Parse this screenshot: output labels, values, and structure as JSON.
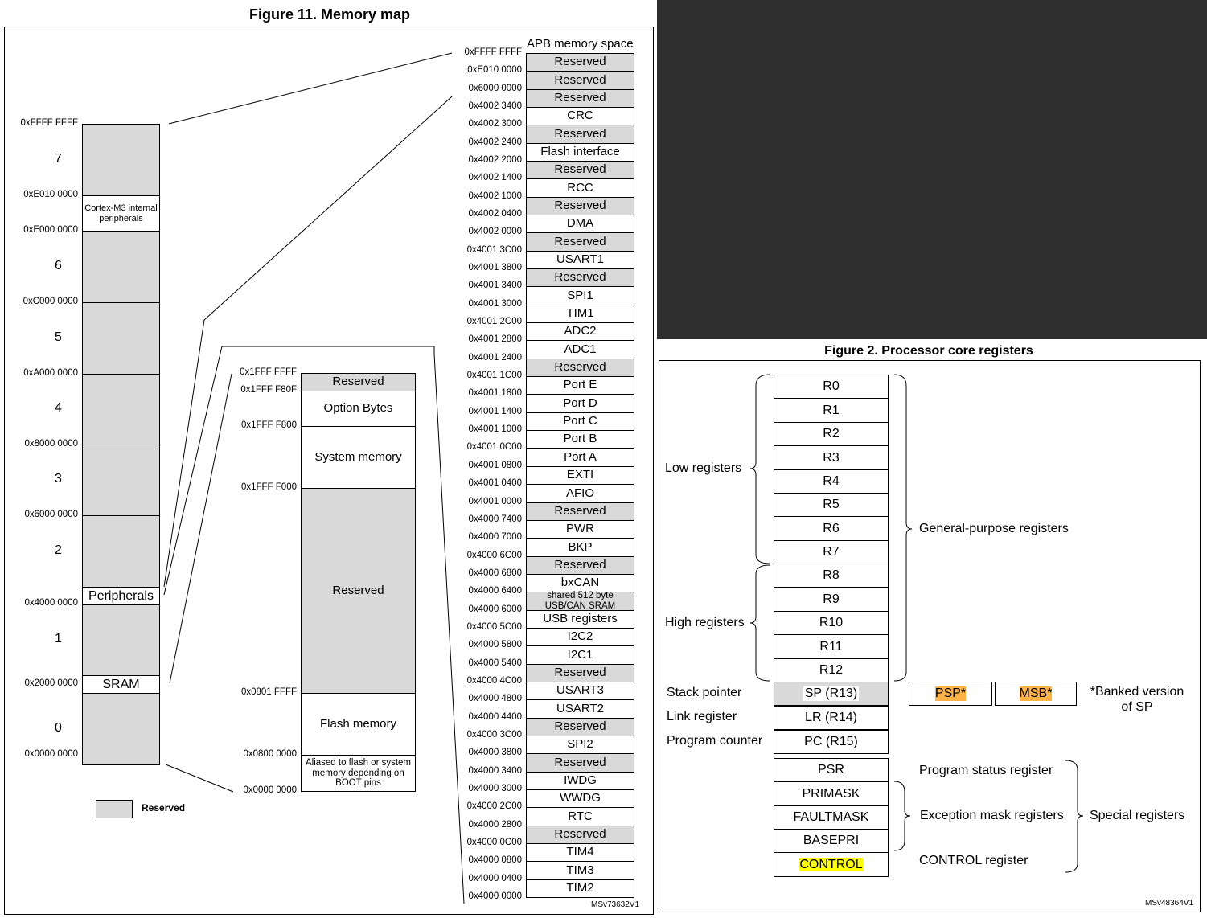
{
  "memory_map": {
    "title": "Figure 11. Memory map",
    "code": "MSv73632V1",
    "legend_label": "Reserved",
    "regions": [
      {
        "label": "7",
        "gray": true
      },
      {
        "label": "Cortex-M3 internal peripherals",
        "gray": false
      },
      {
        "label": "6",
        "gray": true
      },
      {
        "label": "5",
        "gray": true
      },
      {
        "label": "4",
        "gray": true
      },
      {
        "label": "3",
        "gray": true
      },
      {
        "label": "2",
        "gray": true
      },
      {
        "label": "Peripherals",
        "gray": false
      },
      {
        "label": "1",
        "gray": true
      },
      {
        "label": "SRAM",
        "gray": false
      },
      {
        "label": "0",
        "gray": true
      }
    ],
    "addresses": [
      "0xFFFF FFFF",
      "0xE010 0000",
      "0xE000 0000",
      "0xC000 0000",
      "0xA000 0000",
      "0x8000 0000",
      "0x6000 0000",
      "0x4000 0000",
      "0x2000 0000",
      "0x0000 0000"
    ],
    "code_region": {
      "cells": [
        {
          "label": "Reserved",
          "gray": true
        },
        {
          "label": "Option Bytes",
          "gray": false
        },
        {
          "label": "System memory",
          "gray": false
        },
        {
          "label": "Reserved",
          "gray": true
        },
        {
          "label": "Flash memory",
          "gray": false
        },
        {
          "label": "Aliased to flash or system memory depending on BOOT pins",
          "gray": false
        }
      ],
      "addresses": [
        "0x1FFF FFFF",
        "0x1FFF F80F",
        "0x1FFF F800",
        "0x1FFF F000",
        "0x0801 FFFF",
        "0x0800 0000",
        "0x0000 0000"
      ]
    },
    "apb": {
      "title": "APB memory space",
      "cells": [
        {
          "label": "Reserved",
          "gray": true
        },
        {
          "label": "Reserved",
          "gray": true
        },
        {
          "label": "Reserved",
          "gray": true
        },
        {
          "label": "CRC",
          "gray": false
        },
        {
          "label": "Reserved",
          "gray": true
        },
        {
          "label": "Flash interface",
          "gray": false
        },
        {
          "label": "Reserved",
          "gray": true
        },
        {
          "label": "RCC",
          "gray": false
        },
        {
          "label": "Reserved",
          "gray": true
        },
        {
          "label": "DMA",
          "gray": false
        },
        {
          "label": "Reserved",
          "gray": true
        },
        {
          "label": "USART1",
          "gray": false
        },
        {
          "label": "Reserved",
          "gray": true
        },
        {
          "label": "SPI1",
          "gray": false
        },
        {
          "label": "TIM1",
          "gray": false
        },
        {
          "label": "ADC2",
          "gray": false
        },
        {
          "label": "ADC1",
          "gray": false
        },
        {
          "label": "Reserved",
          "gray": true
        },
        {
          "label": "Port E",
          "gray": false
        },
        {
          "label": "Port D",
          "gray": false
        },
        {
          "label": "Port C",
          "gray": false
        },
        {
          "label": "Port B",
          "gray": false
        },
        {
          "label": "Port A",
          "gray": false
        },
        {
          "label": "EXTI",
          "gray": false
        },
        {
          "label": "AFIO",
          "gray": false
        },
        {
          "label": "Reserved",
          "gray": true
        },
        {
          "label": "PWR",
          "gray": false
        },
        {
          "label": "BKP",
          "gray": false
        },
        {
          "label": "Reserved",
          "gray": true
        },
        {
          "label": "bxCAN",
          "gray": false
        },
        {
          "label": "shared 512 byte USB/CAN SRAM",
          "gray": true
        },
        {
          "label": "USB registers",
          "gray": false
        },
        {
          "label": "I2C2",
          "gray": false
        },
        {
          "label": "I2C1",
          "gray": false
        },
        {
          "label": "Reserved",
          "gray": true
        },
        {
          "label": "USART3",
          "gray": false
        },
        {
          "label": "USART2",
          "gray": false
        },
        {
          "label": "Reserved",
          "gray": true
        },
        {
          "label": "SPI2",
          "gray": false
        },
        {
          "label": "Reserved",
          "gray": true
        },
        {
          "label": "IWDG",
          "gray": false
        },
        {
          "label": "WWDG",
          "gray": false
        },
        {
          "label": "RTC",
          "gray": false
        },
        {
          "label": "Reserved",
          "gray": true
        },
        {
          "label": "TIM4",
          "gray": false
        },
        {
          "label": "TIM3",
          "gray": false
        },
        {
          "label": "TIM2",
          "gray": false
        }
      ],
      "addresses": [
        "0xFFFF FFFF",
        "0xE010 0000",
        "0x6000 0000",
        "0x4002 3400",
        "0x4002 3000",
        "0x4002 2400",
        "0x4002 2000",
        "0x4002 1400",
        "0x4002 1000",
        "0x4002 0400",
        "0x4002 0000",
        "0x4001 3C00",
        "0x4001 3800",
        "0x4001 3400",
        "0x4001 3000",
        "0x4001 2C00",
        "0x4001 2800",
        "0x4001 2400",
        "0x4001 1C00",
        "0x4001 1800",
        "0x4001 1400",
        "0x4001 1000",
        "0x4001 0C00",
        "0x4001 0800",
        "0x4001 0400",
        "0x4001 0000",
        "0x4000 7400",
        "0x4000 7000",
        "0x4000 6C00",
        "0x4000 6800",
        "0x4000 6400",
        "0x4000 6000",
        "0x4000 5C00",
        "0x4000 5800",
        "0x4000 5400",
        "0x4000 4C00",
        "0x4000 4800",
        "0x4000 4400",
        "0x4000 3C00",
        "0x4000 3800",
        "0x4000 3400",
        "0x4000 3000",
        "0x4000 2C00",
        "0x4000 2800",
        "0x4000 0C00",
        "0x4000 0800",
        "0x4000 0400",
        "0x4000 0000"
      ]
    }
  },
  "core_registers": {
    "title": "Figure 2. Processor core registers",
    "code": "MSv48364V1",
    "general": [
      "R0",
      "R1",
      "R2",
      "R3",
      "R4",
      "R5",
      "R6",
      "R7",
      "R8",
      "R9",
      "R10",
      "R11",
      "R12"
    ],
    "low_label": "Low registers",
    "high_label": "High registers",
    "general_label": "General-purpose registers",
    "stack_pointer_label": "Stack pointer",
    "link_register_label": "Link register",
    "program_counter_label": "Program counter",
    "sp": "SP (R13)",
    "lr": "LR (R14)",
    "pc": "PC (R15)",
    "psp": "PSP*",
    "msb": "MSB*",
    "banked_note": "*Banked version of SP",
    "special": [
      "PSR",
      "PRIMASK",
      "FAULTMASK",
      "BASEPRI",
      "CONTROL"
    ],
    "psr_label": "Program status register",
    "exception_label": "Exception mask registers",
    "control_label": "CONTROL register",
    "special_label": "Special registers",
    "colors": {
      "orange_highlight": "#ffb347",
      "yellow_highlight": "#ffff00",
      "reserved_gray": "#d9d9d9"
    }
  }
}
